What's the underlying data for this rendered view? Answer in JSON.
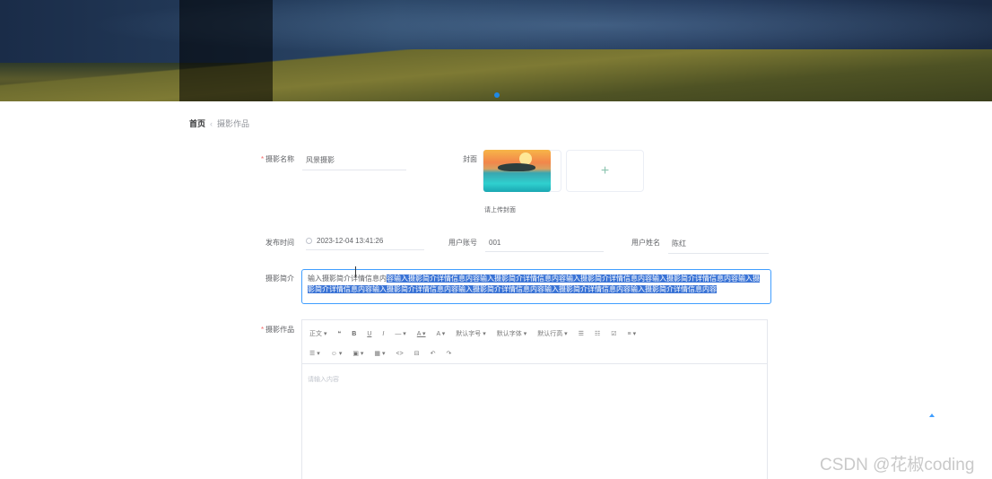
{
  "breadcrumb": {
    "home": "首页",
    "separator": "‹",
    "current": "摄影作品"
  },
  "form": {
    "name": {
      "label": "摄影名称",
      "value": "风景摄影"
    },
    "cover": {
      "label": "封面",
      "tip": "请上传封面",
      "upload_symbol": "+"
    },
    "publish_time": {
      "label": "发布时间",
      "value": "2023-12-04 13:41:26"
    },
    "user_account": {
      "label": "用户账号",
      "value": "001"
    },
    "user_name": {
      "label": "用户姓名",
      "value": "陈红"
    },
    "intro": {
      "label": "摄影简介",
      "value_plain": "输入摄影简介详情信息内",
      "value_selected": "容输入摄影简介详情信息内容输入摄影简介详情信息内容输入摄影简介详情信息内容输入摄影简介详情信息内容输入摄影简介详情信息内容输入摄影简介详情信息内容输入摄影简介详情信息内容输入摄影简介详情信息内容输入摄影简介详情信息内容"
    },
    "works": {
      "label": "摄影作品",
      "placeholder": "请输入内容"
    }
  },
  "editor_toolbar": {
    "row1": [
      "正文 ▾",
      "❝",
      "B",
      "U",
      "I",
      "— ▾",
      "A ▾",
      "A ▾",
      "默认字号 ▾",
      "默认字体 ▾",
      "默认行高 ▾",
      "☰",
      "☷",
      "☑",
      "≡ ▾"
    ],
    "row2": [
      "☰ ▾",
      "☺ ▾",
      "▣ ▾",
      "▦ ▾",
      "<>",
      "⊟",
      "↶",
      "↷"
    ]
  },
  "watermark": "CSDN @花椒coding",
  "colors": {
    "primary": "#409eff",
    "required": "#f56c6c",
    "selection": "#3b74d6"
  }
}
